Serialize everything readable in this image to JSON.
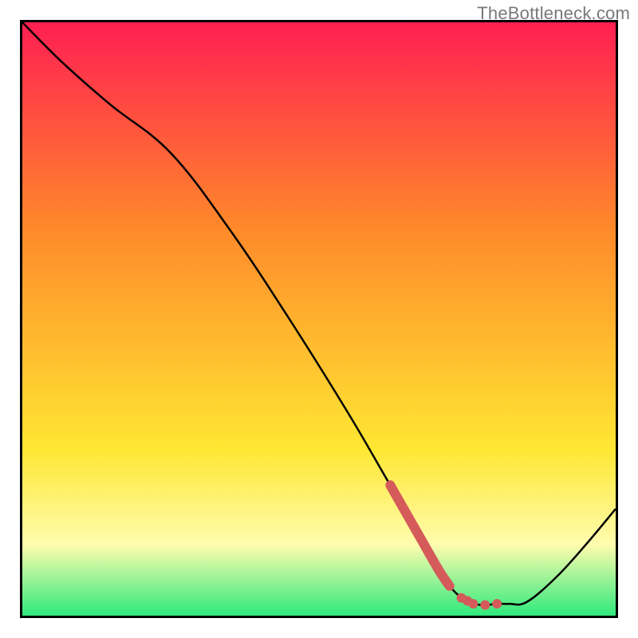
{
  "source_label": "TheBottleneck.com",
  "colors": {
    "top": "#ff1f52",
    "mid1": "#ff8a2a",
    "mid2": "#ffe733",
    "band_pale": "#fffcae",
    "bottom": "#2fe97d",
    "curve": "#000000",
    "trend": "#d55a5a"
  },
  "chart_data": {
    "type": "line",
    "title": "",
    "xlabel": "",
    "ylabel": "",
    "xlim": [
      0,
      100
    ],
    "ylim": [
      0,
      100
    ],
    "series": [
      {
        "name": "bottleneck-curve",
        "x": [
          0,
          7,
          15,
          25,
          35,
          45,
          55,
          62,
          68,
          70,
          72,
          74,
          75,
          76,
          78,
          80,
          82,
          85,
          90,
          95,
          100
        ],
        "y": [
          100,
          93,
          86,
          78,
          65,
          50,
          34,
          22,
          12,
          8,
          5,
          3,
          2.5,
          2,
          1.8,
          2,
          2,
          2.3,
          6.5,
          12,
          18
        ]
      },
      {
        "name": "recommended-range",
        "x": [
          62,
          66,
          70,
          72,
          74,
          75,
          76,
          78,
          80
        ],
        "y": [
          22,
          15,
          8,
          5,
          3,
          2.5,
          2,
          1.8,
          2
        ]
      }
    ]
  }
}
